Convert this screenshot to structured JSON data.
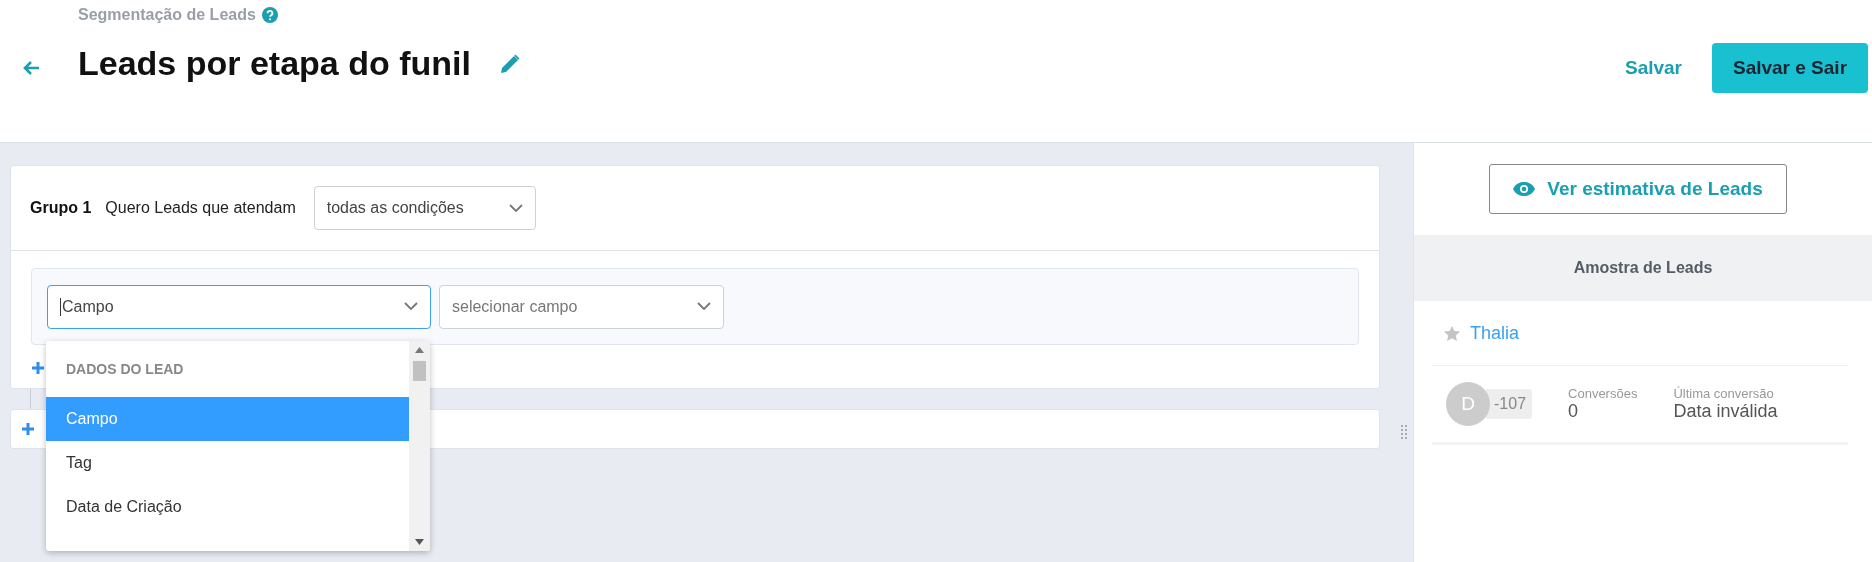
{
  "header": {
    "breadcrumb": "Segmentação de Leads",
    "title": "Leads por etapa do funil",
    "actions": [
      {
        "label": "Salvar",
        "kind": "link"
      },
      {
        "label": "Salvar e Sair",
        "kind": "primary"
      }
    ]
  },
  "group": {
    "name": "Grupo 1",
    "prompt": "Quero Leads que atendam",
    "match": "todas as condições",
    "condition": {
      "field": "Campo",
      "operator_placeholder": "selecionar campo"
    },
    "dropdown": {
      "section": "DADOS DO LEAD",
      "options": [
        {
          "label": "Campo",
          "selected": true
        },
        {
          "label": "Tag",
          "selected": false
        },
        {
          "label": "Data de Criação",
          "selected": false
        }
      ]
    }
  },
  "panel": {
    "estimate_button": "Ver estimativa de Leads",
    "sample_title": "Amostra de Leads",
    "leads": [
      {
        "name": "Thalia",
        "starred": false,
        "avatar": "D",
        "score": "-107",
        "stats": [
          {
            "label": "Conversões",
            "value": "0"
          },
          {
            "label": "Última conversão",
            "value": "Data inválida"
          }
        ]
      }
    ]
  }
}
